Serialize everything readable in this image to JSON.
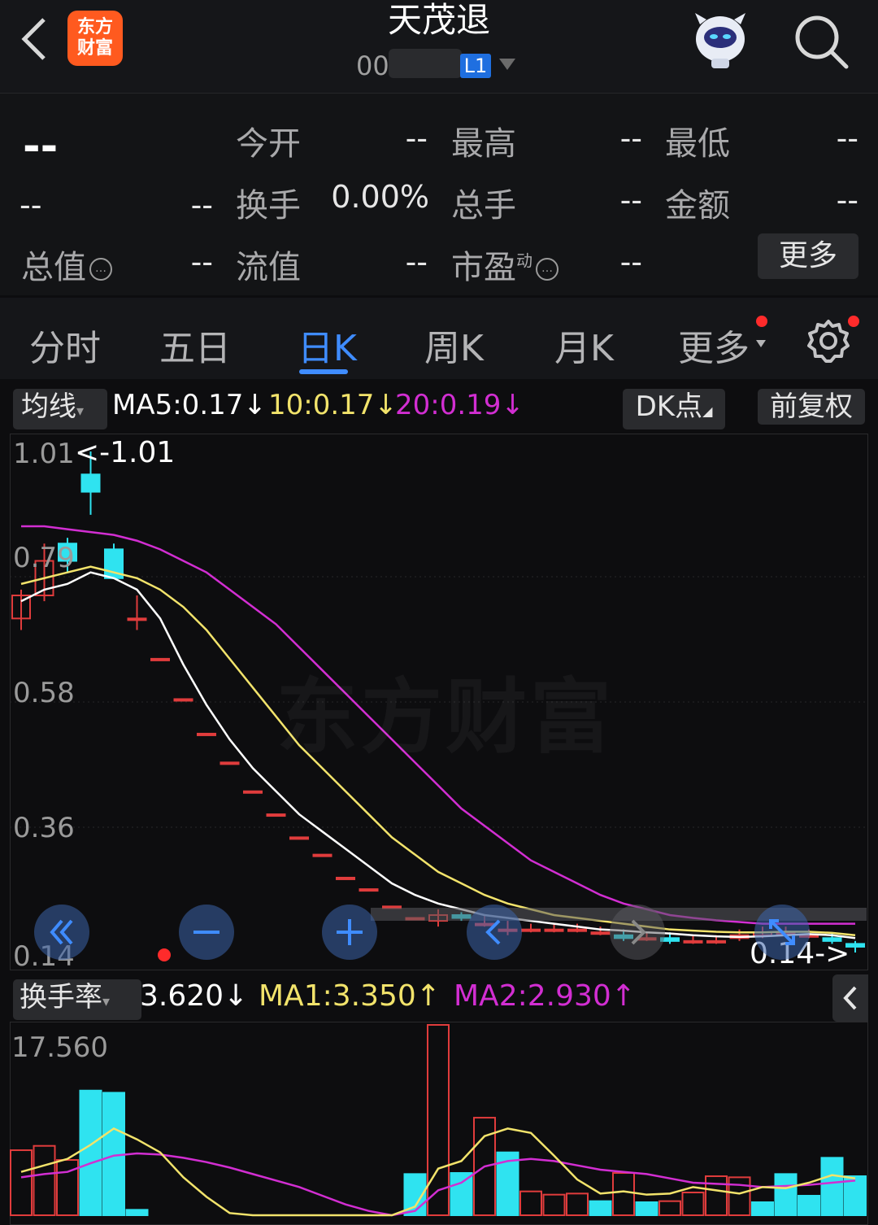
{
  "header": {
    "title": "天茂退",
    "code": "00",
    "level_badge": "L1",
    "logo_line1": "东方",
    "logo_line2": "财富"
  },
  "quote": {
    "price": "--",
    "change": "--",
    "change_pct": "--",
    "open_label": "今开",
    "open_value": "--",
    "high_label": "最高",
    "high_value": "--",
    "low_label": "最低",
    "low_value": "--",
    "turnover_label": "换手",
    "turnover_value": "0.00%",
    "volume_label": "总手",
    "volume_value": "--",
    "amount_label": "金额",
    "amount_value": "--",
    "mktcap_label": "总值",
    "mktcap_value": "--",
    "float_label": "流值",
    "float_value": "--",
    "pe_label": "市盈",
    "pe_sup": "动",
    "pe_value": "--",
    "more_label": "更多"
  },
  "tabs": [
    "分时",
    "五日",
    "日K",
    "周K",
    "月K",
    "更多"
  ],
  "active_tab": "日K",
  "ma_bar": {
    "selector": "均线",
    "ma5": "MA5:0.17↓",
    "ma10": "10:0.17↓",
    "ma20": "20:0.19↓",
    "dk_button": "DK点",
    "adjust_button": "前复权"
  },
  "colors": {
    "up": "#e03c3c",
    "down": "#2fe3f0",
    "ma5": "#ffffff",
    "ma10": "#f2e36b",
    "ma20": "#d22ed2",
    "accent": "#3f8cff"
  },
  "chart_data": [
    {
      "type": "candlestick",
      "y_ticks": [
        "1.01",
        "0.79",
        "0.58",
        "0.36",
        "0.14"
      ],
      "ylim": [
        0.14,
        1.01
      ],
      "annotations": [
        "<-1.01",
        "0.14->"
      ],
      "watermark": "东方财富",
      "candles": [
        {
          "o": 0.72,
          "c": 0.76,
          "h": 0.77,
          "l": 0.7
        },
        {
          "o": 0.76,
          "c": 0.82,
          "h": 0.85,
          "l": 0.75
        },
        {
          "o": 0.85,
          "c": 0.82,
          "h": 0.86,
          "l": 0.8
        },
        {
          "o": 0.97,
          "c": 0.94,
          "h": 1.01,
          "l": 0.9
        },
        {
          "o": 0.84,
          "c": 0.79,
          "h": 0.85,
          "l": 0.79
        },
        {
          "o": 0.72,
          "c": 0.72,
          "h": 0.76,
          "l": 0.7
        },
        {
          "o": 0.65,
          "c": 0.65,
          "h": 0.65,
          "l": 0.65
        },
        {
          "o": 0.58,
          "c": 0.58,
          "h": 0.58,
          "l": 0.58
        },
        {
          "o": 0.52,
          "c": 0.52,
          "h": 0.52,
          "l": 0.52
        },
        {
          "o": 0.47,
          "c": 0.47,
          "h": 0.47,
          "l": 0.47
        },
        {
          "o": 0.42,
          "c": 0.42,
          "h": 0.42,
          "l": 0.42
        },
        {
          "o": 0.38,
          "c": 0.38,
          "h": 0.38,
          "l": 0.38
        },
        {
          "o": 0.34,
          "c": 0.34,
          "h": 0.34,
          "l": 0.34
        },
        {
          "o": 0.31,
          "c": 0.31,
          "h": 0.31,
          "l": 0.31
        },
        {
          "o": 0.27,
          "c": 0.27,
          "h": 0.27,
          "l": 0.27
        },
        {
          "o": 0.25,
          "c": 0.25,
          "h": 0.25,
          "l": 0.25
        },
        {
          "o": 0.22,
          "c": 0.22,
          "h": 0.22,
          "l": 0.22
        },
        {
          "o": 0.2,
          "c": 0.2,
          "h": 0.2,
          "l": 0.2
        },
        {
          "o": 0.195,
          "c": 0.205,
          "h": 0.215,
          "l": 0.185
        },
        {
          "o": 0.205,
          "c": 0.2,
          "h": 0.21,
          "l": 0.195
        },
        {
          "o": 0.19,
          "c": 0.19,
          "h": 0.205,
          "l": 0.185
        },
        {
          "o": 0.18,
          "c": 0.18,
          "h": 0.195,
          "l": 0.17
        },
        {
          "o": 0.18,
          "c": 0.18,
          "h": 0.19,
          "l": 0.175
        },
        {
          "o": 0.18,
          "c": 0.18,
          "h": 0.19,
          "l": 0.175
        },
        {
          "o": 0.18,
          "c": 0.18,
          "h": 0.19,
          "l": 0.175
        },
        {
          "o": 0.175,
          "c": 0.175,
          "h": 0.185,
          "l": 0.17
        },
        {
          "o": 0.17,
          "c": 0.165,
          "h": 0.18,
          "l": 0.16
        },
        {
          "o": 0.165,
          "c": 0.165,
          "h": 0.175,
          "l": 0.16
        },
        {
          "o": 0.165,
          "c": 0.16,
          "h": 0.175,
          "l": 0.155
        },
        {
          "o": 0.16,
          "c": 0.16,
          "h": 0.17,
          "l": 0.155
        },
        {
          "o": 0.16,
          "c": 0.16,
          "h": 0.17,
          "l": 0.155
        },
        {
          "o": 0.165,
          "c": 0.17,
          "h": 0.18,
          "l": 0.16
        },
        {
          "o": 0.17,
          "c": 0.175,
          "h": 0.185,
          "l": 0.165
        },
        {
          "o": 0.175,
          "c": 0.175,
          "h": 0.185,
          "l": 0.17
        },
        {
          "o": 0.17,
          "c": 0.17,
          "h": 0.18,
          "l": 0.165
        },
        {
          "o": 0.165,
          "c": 0.16,
          "h": 0.175,
          "l": 0.155
        },
        {
          "o": 0.155,
          "c": 0.15,
          "h": 0.16,
          "l": 0.14
        }
      ],
      "ma5": [
        0.75,
        0.77,
        0.78,
        0.8,
        0.79,
        0.77,
        0.72,
        0.64,
        0.57,
        0.51,
        0.46,
        0.42,
        0.38,
        0.35,
        0.32,
        0.29,
        0.26,
        0.24,
        0.225,
        0.215,
        0.205,
        0.2,
        0.195,
        0.19,
        0.185,
        0.18,
        0.178,
        0.175,
        0.173,
        0.17,
        0.168,
        0.167,
        0.168,
        0.17,
        0.172,
        0.17,
        0.165
      ],
      "ma10": [
        0.78,
        0.79,
        0.8,
        0.81,
        0.8,
        0.79,
        0.77,
        0.74,
        0.7,
        0.65,
        0.6,
        0.55,
        0.5,
        0.46,
        0.42,
        0.38,
        0.34,
        0.31,
        0.28,
        0.26,
        0.24,
        0.225,
        0.215,
        0.205,
        0.2,
        0.195,
        0.19,
        0.185,
        0.18,
        0.178,
        0.176,
        0.175,
        0.175,
        0.176,
        0.176,
        0.174,
        0.17
      ],
      "ma20": [
        0.88,
        0.88,
        0.875,
        0.87,
        0.865,
        0.855,
        0.84,
        0.82,
        0.8,
        0.77,
        0.74,
        0.71,
        0.67,
        0.63,
        0.59,
        0.55,
        0.51,
        0.47,
        0.43,
        0.39,
        0.36,
        0.33,
        0.3,
        0.28,
        0.26,
        0.24,
        0.225,
        0.215,
        0.205,
        0.2,
        0.196,
        0.193,
        0.19,
        0.19,
        0.19,
        0.19,
        0.19
      ]
    },
    {
      "type": "bar",
      "title": "换手率",
      "value_label": "3.620↓",
      "ma1_label": "MA1:3.350↑",
      "ma2_label": "MA2:2.930↑",
      "y_ticks": [
        "17.560"
      ],
      "ylim": [
        0,
        17.56
      ],
      "bars": [
        {
          "v": 6.0,
          "up": true
        },
        {
          "v": 6.4,
          "up": true
        },
        {
          "v": 5.1,
          "up": true
        },
        {
          "v": 11.5,
          "up": false
        },
        {
          "v": 11.3,
          "up": false
        },
        {
          "v": 0.5,
          "up": false
        },
        {
          "v": 0,
          "up": false
        },
        {
          "v": 0,
          "up": false
        },
        {
          "v": 0,
          "up": false
        },
        {
          "v": 0,
          "up": false
        },
        {
          "v": 0,
          "up": false
        },
        {
          "v": 0,
          "up": false
        },
        {
          "v": 0,
          "up": false
        },
        {
          "v": 0,
          "up": false
        },
        {
          "v": 0,
          "up": false
        },
        {
          "v": 0,
          "up": false
        },
        {
          "v": 0,
          "up": false
        },
        {
          "v": 3.8,
          "up": false
        },
        {
          "v": 17.56,
          "up": true
        },
        {
          "v": 3.9,
          "up": false
        },
        {
          "v": 9.0,
          "up": true
        },
        {
          "v": 5.8,
          "up": false
        },
        {
          "v": 2.2,
          "up": true
        },
        {
          "v": 1.9,
          "up": true
        },
        {
          "v": 2.0,
          "up": true
        },
        {
          "v": 1.3,
          "up": false
        },
        {
          "v": 3.9,
          "up": true
        },
        {
          "v": 1.2,
          "up": false
        },
        {
          "v": 1.3,
          "up": true
        },
        {
          "v": 2.1,
          "up": true
        },
        {
          "v": 3.6,
          "up": true
        },
        {
          "v": 3.5,
          "up": true
        },
        {
          "v": 1.2,
          "up": false
        },
        {
          "v": 3.8,
          "up": false
        },
        {
          "v": 1.8,
          "up": false
        },
        {
          "v": 5.3,
          "up": false
        },
        {
          "v": 3.6,
          "up": false
        }
      ],
      "ma1": [
        4.0,
        4.6,
        5.2,
        6.5,
        8.0,
        7.0,
        5.8,
        3.5,
        1.7,
        0.2,
        0,
        0,
        0,
        0,
        0,
        0,
        0,
        0.8,
        4.3,
        5.0,
        7.3,
        8.0,
        7.6,
        5.5,
        3.3,
        2.0,
        2.2,
        1.9,
        2.0,
        2.6,
        2.3,
        2.0,
        2.6,
        2.5,
        3.0,
        3.7,
        3.4
      ],
      "ma2": [
        3.5,
        3.8,
        4.0,
        4.8,
        5.5,
        5.7,
        5.6,
        5.3,
        4.9,
        4.4,
        3.8,
        3.2,
        2.6,
        1.8,
        1.0,
        0.4,
        0,
        0.4,
        2.3,
        3.0,
        4.5,
        5.0,
        5.2,
        5.0,
        4.6,
        4.2,
        4.0,
        3.8,
        3.4,
        3.0,
        2.9,
        2.8,
        2.6,
        2.7,
        2.8,
        3.0,
        3.2
      ]
    }
  ]
}
